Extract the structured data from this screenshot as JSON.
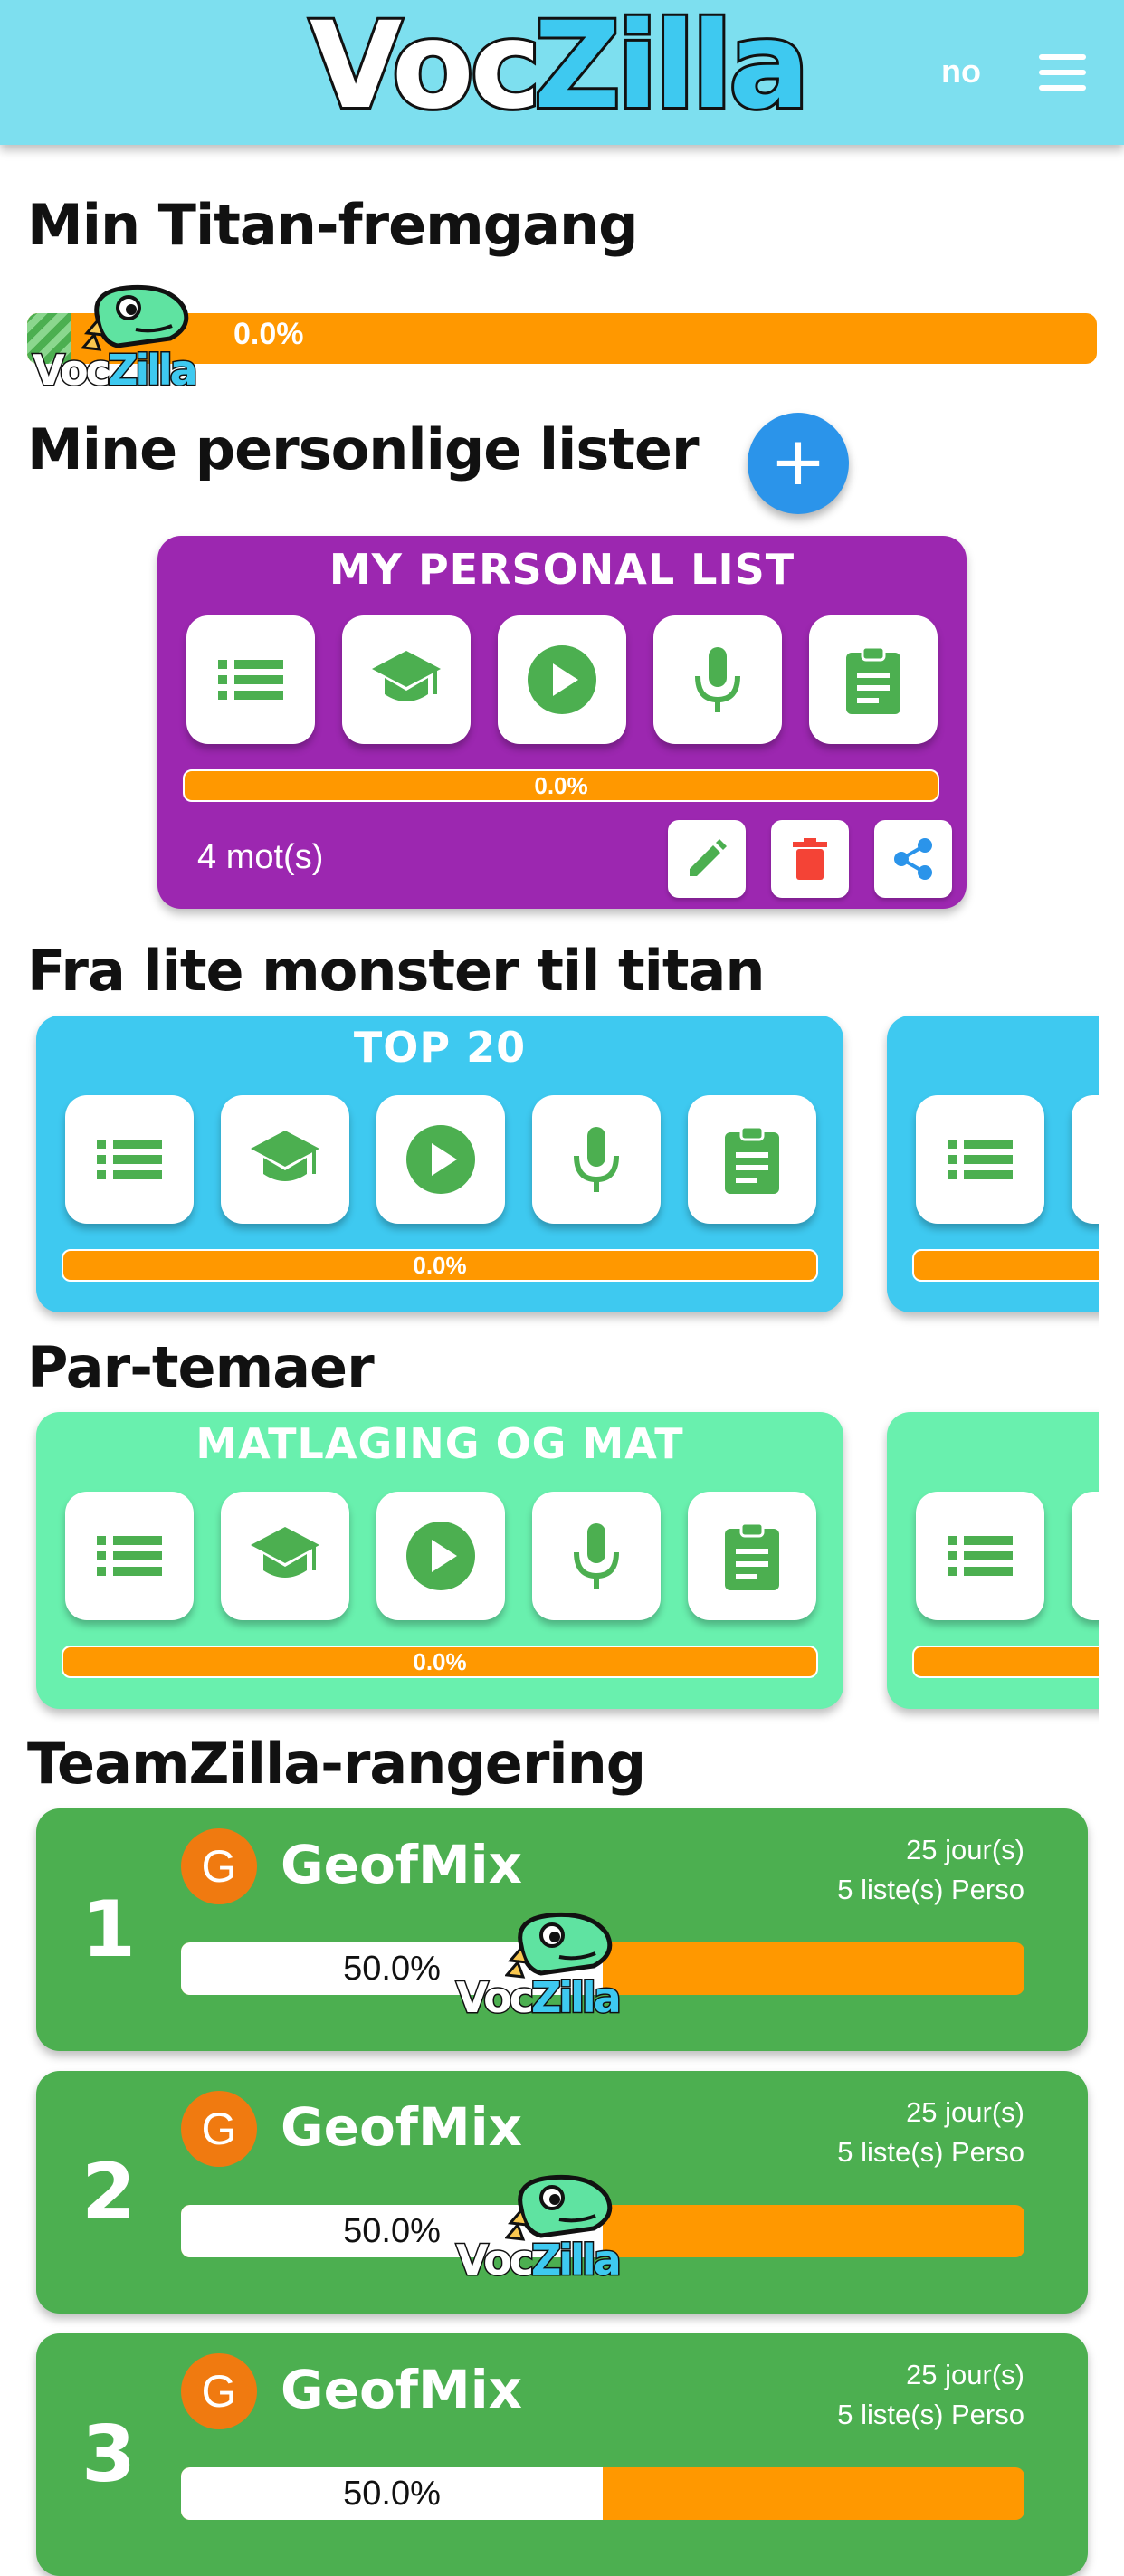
{
  "header": {
    "logo_voc": "Voc",
    "logo_zilla": "Zilla",
    "language": "no"
  },
  "titan": {
    "title": "Min Titan-fremgang",
    "progress_label": "0.0%",
    "progress": 0.0
  },
  "mascot": {
    "voc": "Voc",
    "zilla": "Zilla"
  },
  "personal": {
    "title": "Mine personlige lister",
    "add_label": "+",
    "card": {
      "title": "MY PERSONAL LIST",
      "progress_label": "0.0%",
      "word_count": "4 mot(s)",
      "color": "#9c27b0"
    }
  },
  "monster": {
    "title": "Fra lite monster til titan",
    "card": {
      "title": "TOP 20",
      "progress_label": "0.0%",
      "color": "#3ec9f0"
    }
  },
  "themes": {
    "title": "Par-temaer",
    "card": {
      "title": "MATLAGING OG MAT",
      "progress_label": "0.0%",
      "color": "#69f0ae"
    }
  },
  "ranking": {
    "title": "TeamZilla-rangering",
    "rows": [
      {
        "rank": "1",
        "initial": "G",
        "name": "GeofMix",
        "days": "25 jour(s)",
        "lists": "5 liste(s) Perso",
        "progress_label": "50.0%",
        "progress": 0.5
      },
      {
        "rank": "2",
        "initial": "G",
        "name": "GeofMix",
        "days": "25 jour(s)",
        "lists": "5 liste(s) Perso",
        "progress_label": "50.0%",
        "progress": 0.5
      },
      {
        "rank": "3",
        "initial": "G",
        "name": "GeofMix",
        "days": "25 jour(s)",
        "lists": "5 liste(s) Perso",
        "progress_label": "50.0%",
        "progress": 0.5
      }
    ]
  },
  "colors": {
    "accent_green": "#4caf50",
    "orange": "#ff9800",
    "blue": "#2b94ea",
    "header": "#7ddfef"
  },
  "icons": [
    "list-icon",
    "graduation-cap-icon",
    "play-icon",
    "microphone-icon",
    "clipboard-icon",
    "pencil-icon",
    "trash-icon",
    "share-icon"
  ]
}
